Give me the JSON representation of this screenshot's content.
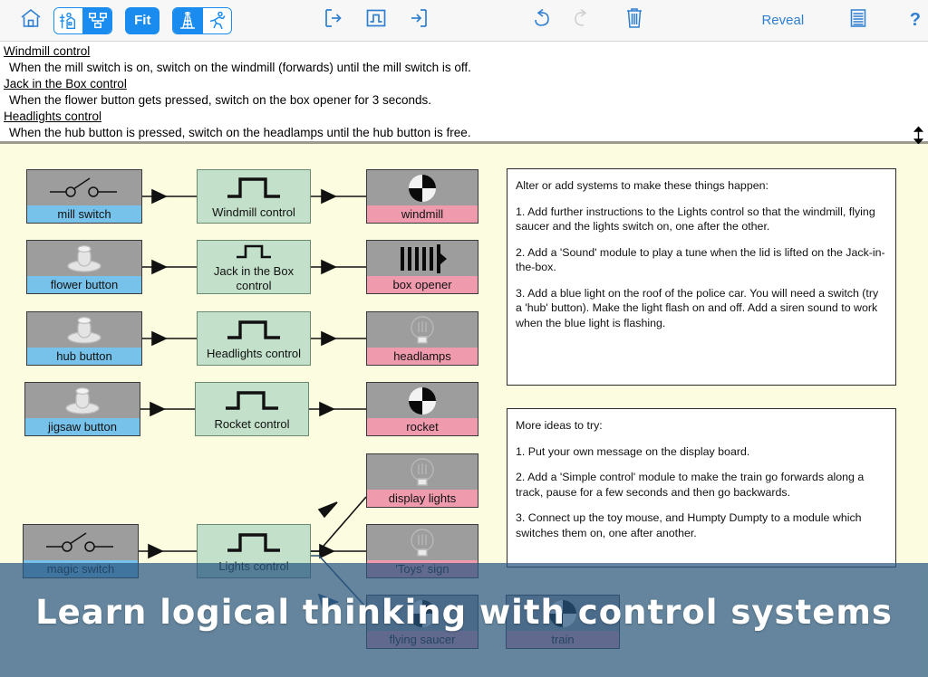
{
  "toolbar": {
    "home_icon": "home-icon",
    "view_segment": [
      {
        "icon": "scene-view-icon",
        "selected": false
      },
      {
        "icon": "systems-view-icon",
        "selected": true
      }
    ],
    "fit_label": "Fit",
    "mode_segment": [
      {
        "icon": "build-tower-icon",
        "selected": true
      },
      {
        "icon": "run-person-icon",
        "selected": false
      }
    ],
    "input_icon": "input-arrow-icon",
    "control_icon": "pulse-control-icon",
    "output_icon": "output-arrow-icon",
    "undo_icon": "undo-icon",
    "redo_icon": "redo-icon",
    "delete_icon": "trash-icon",
    "reveal_label": "Reveal",
    "list_icon": "list-lines-icon",
    "help_label": "?"
  },
  "rules": [
    {
      "title": "Windmill control",
      "body": "When the mill switch is on, switch on the windmill (forwards) until the mill switch is off."
    },
    {
      "title": "Jack in the Box control",
      "body": "When the flower button gets pressed, switch on the box opener for 3 seconds."
    },
    {
      "title": "Headlights control",
      "body": "When the hub button is pressed, switch on the headlamps until the hub button is free."
    }
  ],
  "resize_handle_icon": "vertical-resize-icon",
  "diagram": {
    "inputs": [
      {
        "label": "mill switch",
        "icon": "lever-switch-icon"
      },
      {
        "label": "flower button",
        "icon": "push-button-icon"
      },
      {
        "label": "hub button",
        "icon": "push-button-icon"
      },
      {
        "label": "jigsaw button",
        "icon": "push-button-icon"
      },
      {
        "label": "magic switch",
        "icon": "lever-switch-icon"
      }
    ],
    "controls": [
      {
        "label": "Windmill control",
        "icon": "pulse-icon"
      },
      {
        "label": "Jack in the Box control",
        "icon": "pulse-icon"
      },
      {
        "label": "Headlights control",
        "icon": "pulse-icon"
      },
      {
        "label": "Rocket control",
        "icon": "pulse-icon"
      },
      {
        "label": "Lights control",
        "icon": "pulse-icon"
      }
    ],
    "outputs": [
      {
        "label": "windmill",
        "icon": "motor-wheel-icon"
      },
      {
        "label": "box opener",
        "icon": "solenoid-icon"
      },
      {
        "label": "headlamps",
        "icon": "lamp-bulb-icon"
      },
      {
        "label": "rocket",
        "icon": "motor-wheel-icon"
      },
      {
        "label": "display lights",
        "icon": "lamp-bulb-icon"
      },
      {
        "label": "'Toys' sign",
        "icon": "lamp-bulb-icon"
      },
      {
        "label": "flying saucer",
        "icon": "motor-wheel-icon"
      },
      {
        "label": "train",
        "icon": "motor-wheel-icon"
      }
    ]
  },
  "panels": [
    {
      "name": "tasks-panel",
      "lines": [
        "Alter or add systems to make these things happen:",
        "1. Add further instructions to the Lights control so that the windmill, flying saucer and the lights switch on, one after the other.",
        "2. Add a 'Sound' module to play a tune when the lid is lifted on the Jack-in-the-box.",
        "3. Add a blue light on the roof of the police car. You will need a switch (try a 'hub' button). Make the light flash on and off.  Add a siren sound to work when the blue light is flashing."
      ]
    },
    {
      "name": "more-ideas-panel",
      "lines": [
        "More ideas to try:",
        "1. Put your own message on the display board.",
        "2. Add a 'Simple control' module to make the train go forwards along a track, pause for a few seconds and then go backwards.",
        "3. Connect up the toy mouse, and Humpty Dumpty to a module which switches them on, one after another."
      ]
    }
  ],
  "caption": "Learn logical thinking with control systems",
  "colors": {
    "accent_blue": "#1a8cf0",
    "canvas_bg": "#fcfce0",
    "input_caption": "#77c2ea",
    "output_caption": "#ef9aad",
    "control_fill": "#c3e0ca",
    "node_body": "#9d9d9d",
    "overlay": "#2a5882"
  }
}
